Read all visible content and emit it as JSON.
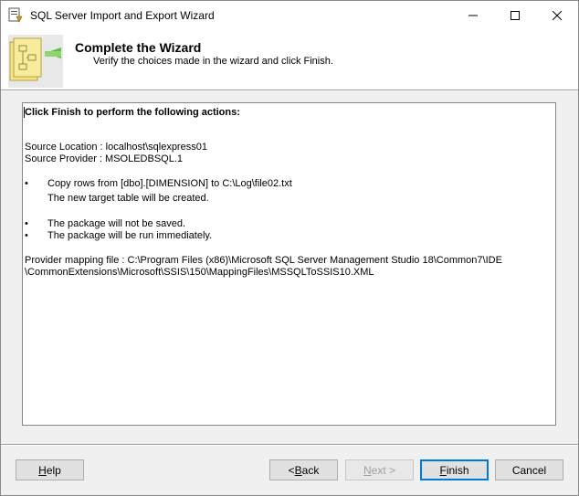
{
  "window": {
    "title": "SQL Server Import and Export Wizard"
  },
  "header": {
    "title": "Complete the Wizard",
    "subtitle": "Verify the choices made in the wizard and click Finish."
  },
  "summary": {
    "intro": "Click Finish to perform the following actions:",
    "source_location": "Source Location : localhost\\sqlexpress01",
    "source_provider": "Source Provider : MSOLEDBSQL.1",
    "bullet_symbol": "•",
    "copy_rows": "Copy rows from [dbo].[DIMENSION] to C:\\Log\\file02.txt",
    "new_table": "The new target table will be created.",
    "not_saved": "The package will not be saved.",
    "run_immediately": "The package will be run immediately.",
    "mapping_line1": "Provider mapping file : C:\\Program Files (x86)\\Microsoft SQL Server Management Studio 18\\Common7\\IDE",
    "mapping_line2": "\\CommonExtensions\\Microsoft\\SSIS\\150\\MappingFiles\\MSSQLToSSIS10.XML"
  },
  "buttons": {
    "help": {
      "pre": "",
      "u": "H",
      "post": "elp"
    },
    "back": {
      "pre": "< ",
      "u": "B",
      "post": "ack"
    },
    "next": {
      "pre": "",
      "u": "N",
      "post": "ext >"
    },
    "finish": {
      "pre": "",
      "u": "F",
      "post": "inish"
    },
    "cancel": {
      "pre": "",
      "u": "",
      "post": "Cancel"
    }
  },
  "colors": {
    "accent": "#0078d7",
    "disabled_text": "#a0a0a0"
  }
}
